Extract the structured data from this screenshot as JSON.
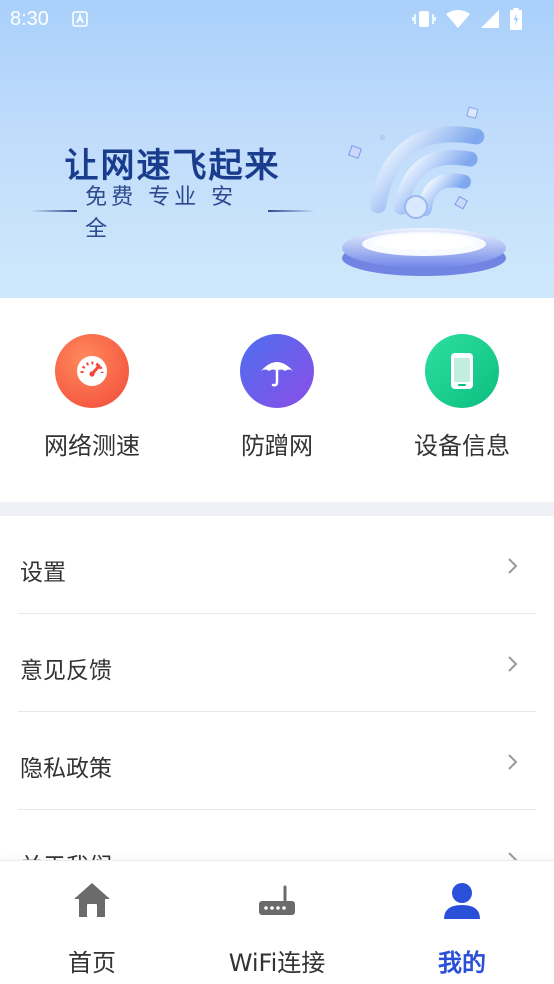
{
  "status_bar": {
    "time": "8:30"
  },
  "banner": {
    "title": "让网速飞起来",
    "subtitle": "免费 专业 安全"
  },
  "tools": [
    {
      "label": "网络测速",
      "icon": "speedometer-icon",
      "color": "#f4553b"
    },
    {
      "label": "防蹭网",
      "icon": "umbrella-icon",
      "color": "#6a5ae8"
    },
    {
      "label": "设备信息",
      "icon": "phone-icon",
      "color": "#13c98a"
    }
  ],
  "menu": {
    "items": [
      {
        "label": "设置"
      },
      {
        "label": "意见反馈"
      },
      {
        "label": "隐私政策"
      },
      {
        "label": "关于我们"
      }
    ]
  },
  "bottom_nav": {
    "items": [
      {
        "label": "首页",
        "icon": "home-icon"
      },
      {
        "label": "WiFi连接",
        "icon": "router-icon"
      },
      {
        "label": "我的",
        "icon": "user-icon"
      }
    ],
    "active_index": 2,
    "active_color": "#2a4fd8"
  }
}
